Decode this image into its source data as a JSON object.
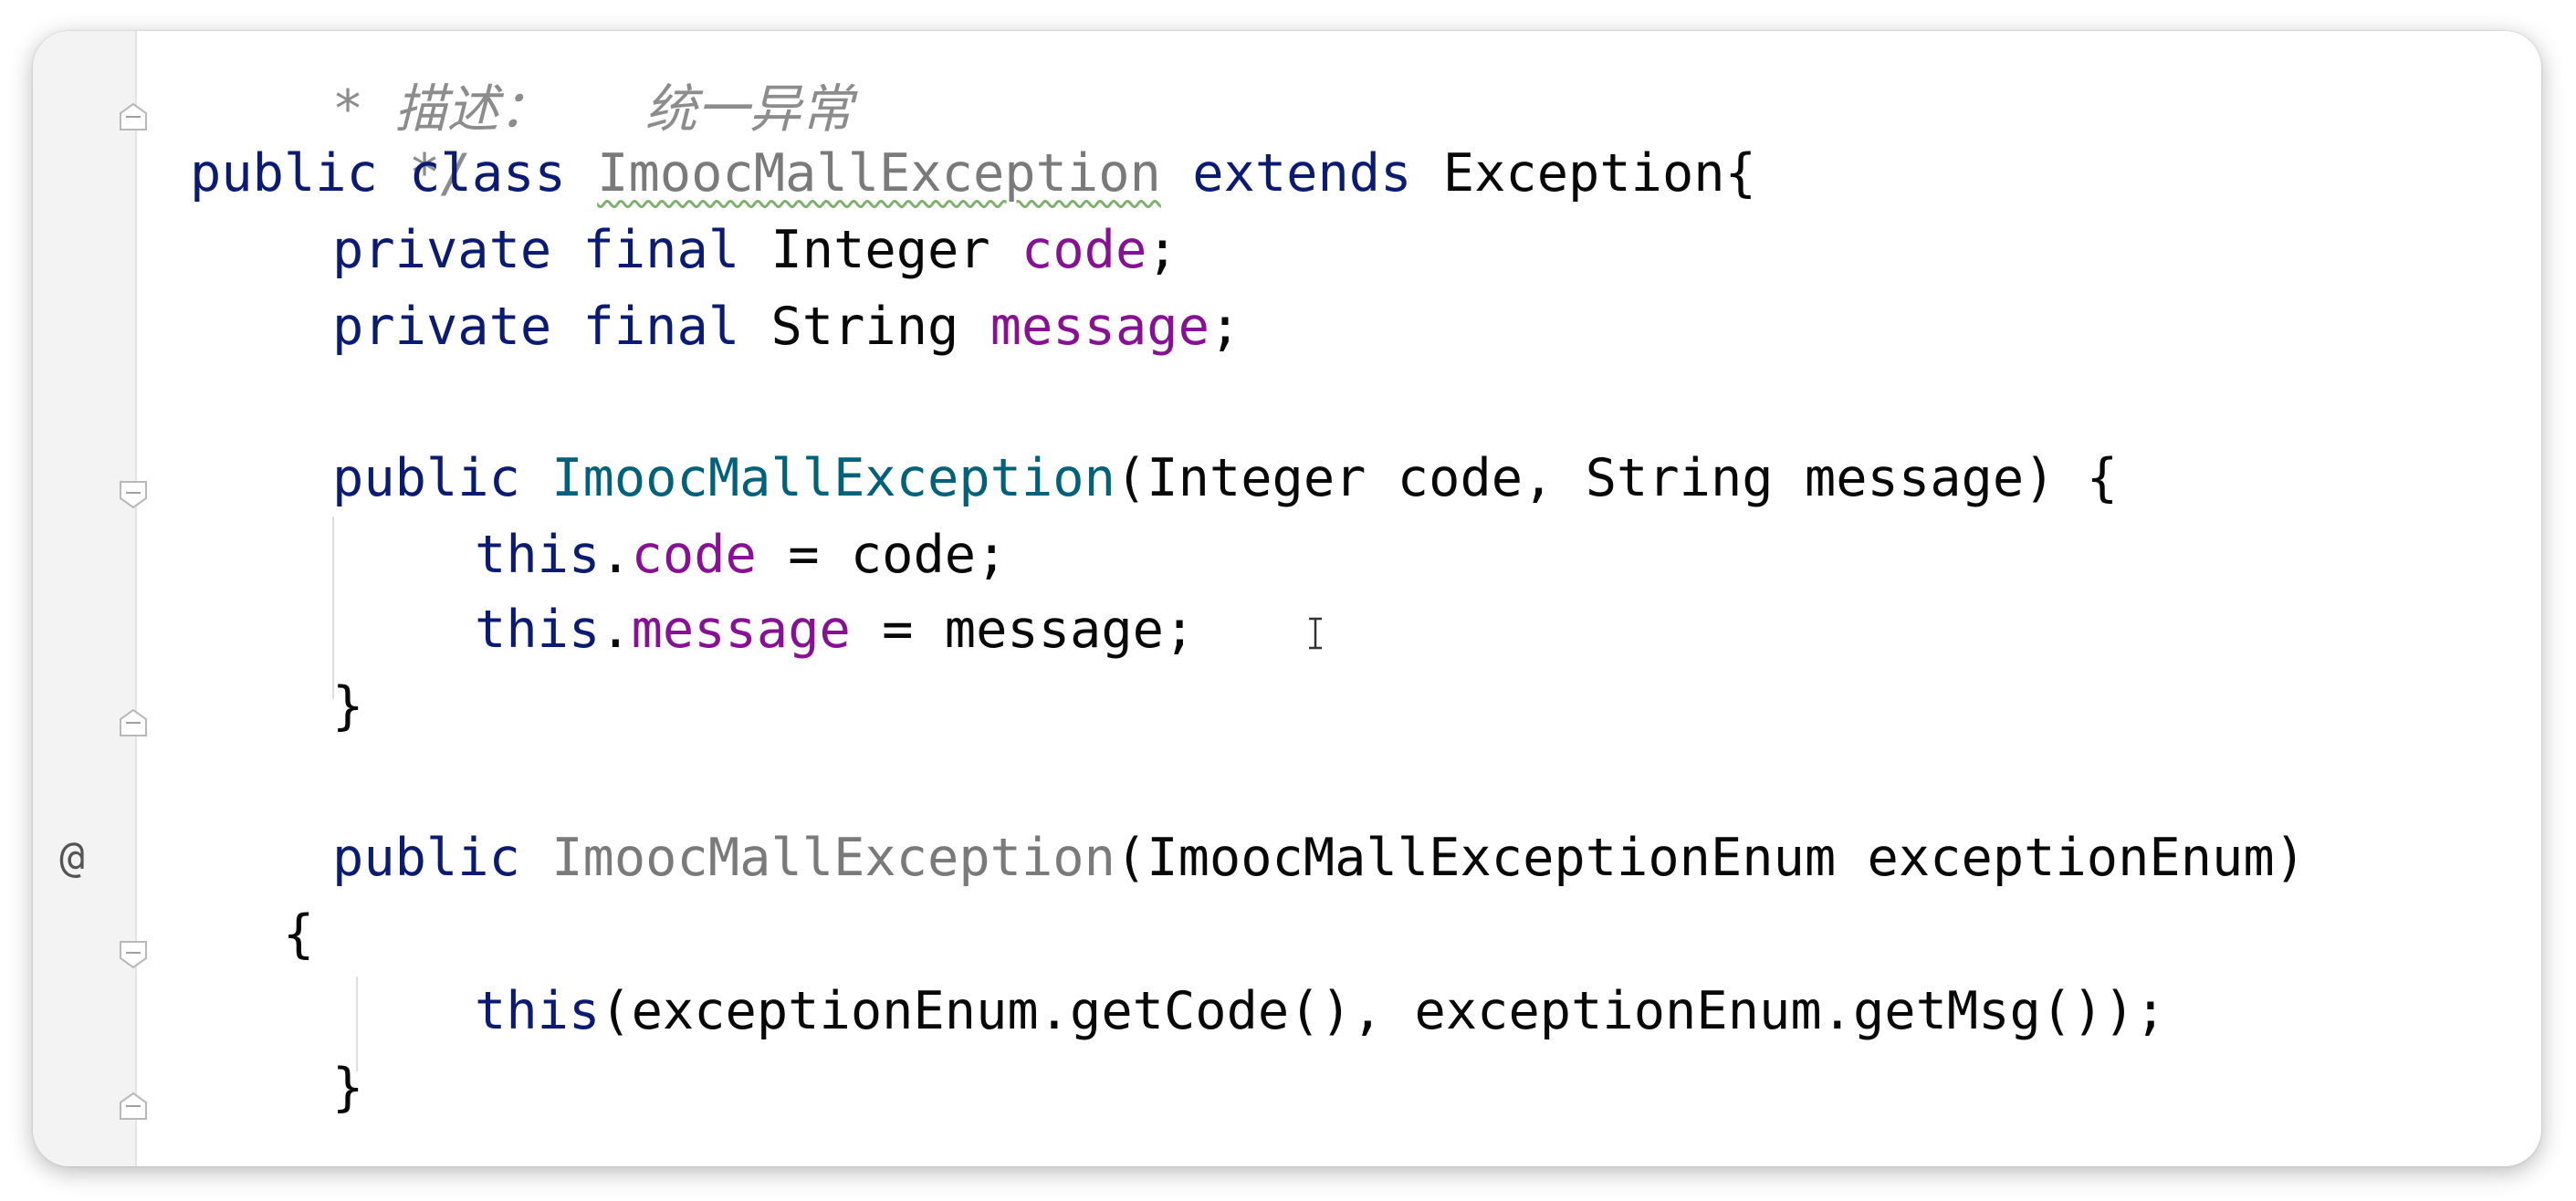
{
  "editor": {
    "gutter_annotation": "@",
    "lines": {
      "l0_comment": "* 描述：   统一异常",
      "l1_comment_end": "*/",
      "l2": {
        "k1": "public",
        "k2": "class",
        "name": "ImoocMallException",
        "k3": "extends",
        "base": "Exception{"
      },
      "l3": {
        "k1": "private",
        "k2": "final",
        "type": "Integer",
        "field": "code",
        "end": ";"
      },
      "l4": {
        "k1": "private",
        "k2": "final",
        "type": "String",
        "field": "message",
        "end": ";"
      },
      "l6": {
        "k1": "public",
        "name": "ImoocMallException",
        "rest": "(Integer code, String message) {"
      },
      "l7": {
        "k1": "this",
        "dot": ".",
        "field": "code",
        "rest": " = code;"
      },
      "l8": {
        "k1": "this",
        "dot": ".",
        "field": "message",
        "rest": " = message;"
      },
      "l9": "}",
      "l11": {
        "k1": "public",
        "name": "ImoocMallException",
        "rest": "(ImoocMallExceptionEnum exceptionEnum)"
      },
      "l12": "{",
      "l13": {
        "k1": "this",
        "rest": "(exceptionEnum.getCode(), exceptionEnum.getMsg());"
      },
      "l14": "}"
    }
  },
  "colors": {
    "keyword": "#0b1b73",
    "field": "#871094",
    "unused_class": "#7a7a7a",
    "constructor": "#00627a",
    "default_text": "#080808"
  }
}
